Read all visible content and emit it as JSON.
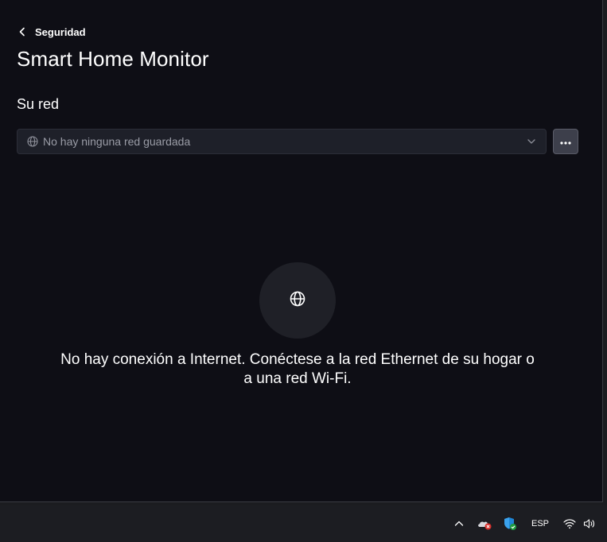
{
  "header": {
    "back_label": "Seguridad",
    "title": "Smart Home Monitor"
  },
  "network": {
    "section_title": "Su red",
    "select_value": "No hay ninguna red guardada"
  },
  "empty_state": {
    "message": "No hay conexión a Internet. Conéctese a la red Ethernet de su hogar o a una red Wi-Fi."
  },
  "taskbar": {
    "language": "ESP"
  },
  "colors": {
    "background": "#0e0e15",
    "select_bg": "#1e2029",
    "more_button_bg": "#3d3f4b",
    "taskbar_bg": "#1c1d22"
  },
  "icons": [
    "chevron-left-icon",
    "globe-icon",
    "chevron-down-icon",
    "more-icon",
    "chevron-up-icon",
    "onedrive-error-icon",
    "security-shield-icon",
    "wifi-icon",
    "volume-icon"
  ]
}
